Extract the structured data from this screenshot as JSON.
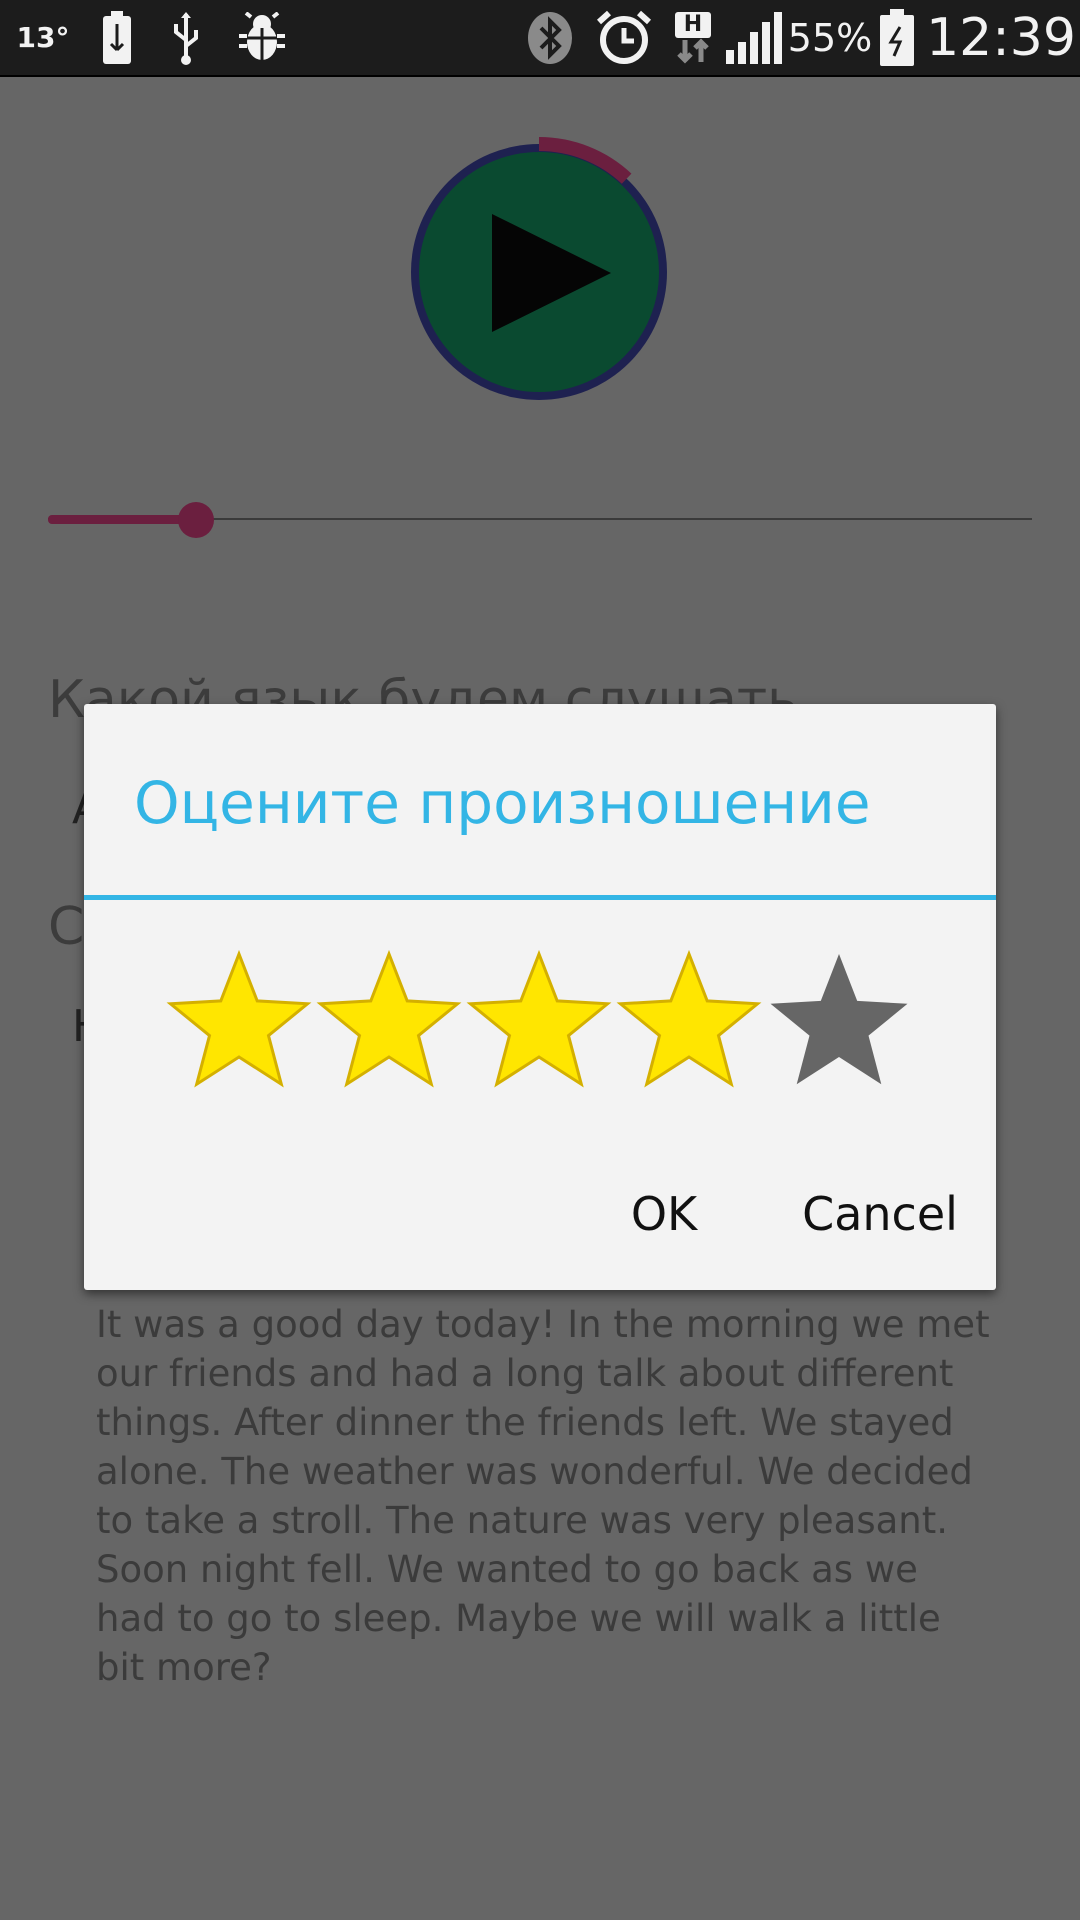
{
  "status_bar": {
    "temperature": "13°",
    "battery_percent": "55%",
    "time": "12:39",
    "network_type": "H",
    "icons": [
      "battery-status-icon",
      "usb-icon",
      "debug-icon",
      "bluetooth-icon",
      "alarm-icon",
      "network-h-icon",
      "signal-icon",
      "battery-icon"
    ]
  },
  "player": {
    "play_icon": "play-icon",
    "progress_ring_fraction": 0.12,
    "seek_fraction": 0.15,
    "colors": {
      "ring": "#1e2150",
      "ring_progress": "#6b1f3f",
      "button": "#0a4a30",
      "seek": "#6b1f3f"
    }
  },
  "background_content": {
    "language_question": "Какой язык будем слушать",
    "language_value": "A",
    "section_label": "C",
    "section_value": "H",
    "story_text": "It was a good day today! In the morning we met our friends and had a long talk about different things. After dinner the friends left. We stayed alone. The weather was wonderful. We decided to take a stroll. The nature was very pleasant. Soon night fell. We wanted to go back as we had to go to sleep. Maybe we will walk a little bit more?"
  },
  "dialog": {
    "title": "Оцените произношение",
    "rating": 4,
    "max_rating": 5,
    "ok_label": "OK",
    "cancel_label": "Cancel",
    "accent_color": "#33b5e5",
    "star_filled_color": "#ffe600",
    "star_empty_color": "#666666"
  }
}
